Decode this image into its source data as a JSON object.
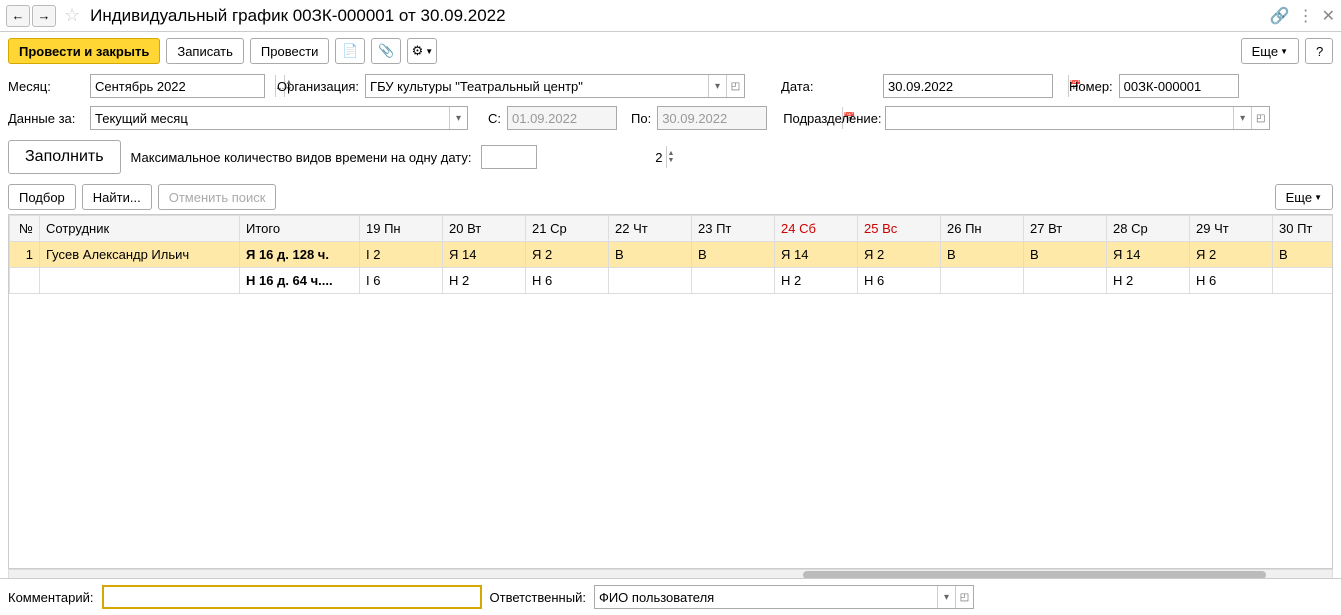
{
  "title": "Индивидуальный график 00ЗК-000001 от 30.09.2022",
  "toolbar": {
    "post_close": "Провести и закрыть",
    "save": "Записать",
    "post": "Провести",
    "more": "Еще",
    "help": "?"
  },
  "form": {
    "month_label": "Месяц:",
    "month_value": "Сентябрь 2022",
    "org_label": "Организация:",
    "org_value": "ГБУ культуры \"Театральный центр\"",
    "date_label": "Дата:",
    "date_value": "30.09.2022",
    "number_label": "Номер:",
    "number_value": "00ЗК-000001",
    "data_for_label": "Данные за:",
    "data_for_value": "Текущий месяц",
    "from_label": "С:",
    "from_value": "01.09.2022",
    "to_label": "По:",
    "to_value": "30.09.2022",
    "dept_label": "Подразделение:",
    "dept_value": ""
  },
  "fill": {
    "button": "Заполнить",
    "max_label": "Максимальное количество видов времени на одну дату:",
    "max_value": "2"
  },
  "actions": {
    "select": "Подбор",
    "find": "Найти...",
    "cancel_search": "Отменить поиск",
    "more": "Еще"
  },
  "table": {
    "headers": {
      "num": "№",
      "employee": "Сотрудник",
      "total": "Итого",
      "days": [
        {
          "label": "19 Пн",
          "weekend": false
        },
        {
          "label": "20 Вт",
          "weekend": false
        },
        {
          "label": "21 Ср",
          "weekend": false
        },
        {
          "label": "22 Чт",
          "weekend": false
        },
        {
          "label": "23 Пт",
          "weekend": false
        },
        {
          "label": "24 Сб",
          "weekend": true
        },
        {
          "label": "25 Вс",
          "weekend": true
        },
        {
          "label": "26 Пн",
          "weekend": false
        },
        {
          "label": "27 Вт",
          "weekend": false
        },
        {
          "label": "28 Ср",
          "weekend": false
        },
        {
          "label": "29 Чт",
          "weekend": false
        },
        {
          "label": "30 Пт",
          "weekend": false
        }
      ]
    },
    "rows": [
      {
        "num": "1",
        "employee": "Гусев Александр Ильич",
        "total": "Я 16 д. 128 ч.",
        "cells": [
          "I 2",
          "Я 14",
          "Я 2",
          "В",
          "В",
          "Я 14",
          "Я 2",
          "В",
          "В",
          "Я 14",
          "Я 2",
          "В"
        ],
        "selected": true
      },
      {
        "num": "",
        "employee": "",
        "total": "Н 16 д. 64 ч....",
        "cells": [
          "I 6",
          "Н 2",
          "Н 6",
          "",
          "",
          "Н 2",
          "Н 6",
          "",
          "",
          "Н 2",
          "Н 6",
          ""
        ],
        "selected": false
      }
    ]
  },
  "footer": {
    "comment_label": "Комментарий:",
    "comment_value": "",
    "responsible_label": "Ответственный:",
    "responsible_value": "ФИО пользователя"
  }
}
